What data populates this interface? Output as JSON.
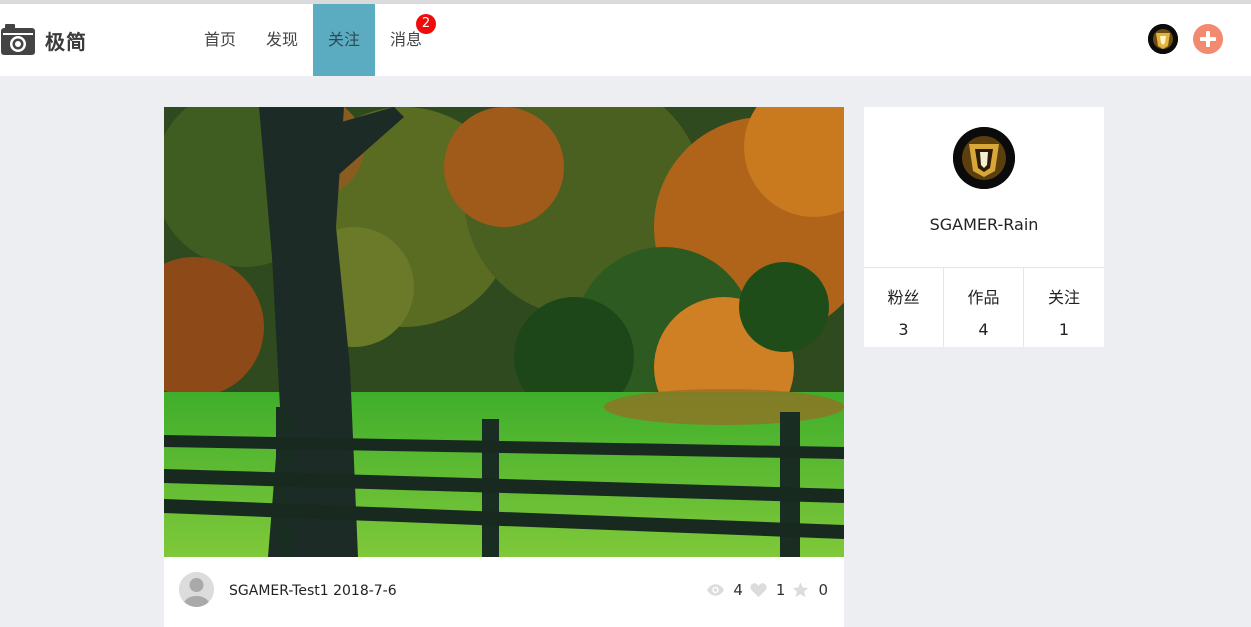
{
  "header": {
    "logo_text": "极简",
    "nav": [
      {
        "label": "首页",
        "active": false
      },
      {
        "label": "发现",
        "active": false
      },
      {
        "label": "关注",
        "active": true
      },
      {
        "label": "消息",
        "active": false,
        "badge": "2"
      }
    ],
    "avatar_icon": "user-avatar-icon",
    "add_icon": "plus-circle-icon"
  },
  "post": {
    "image_icon": "autumn-tree-fence-photo",
    "author": "SGAMER-Test1",
    "date": "2018-7-6",
    "views": "4",
    "likes": "1",
    "favorites": "0",
    "icons": {
      "views": "eye-icon",
      "likes": "heart-icon",
      "favorites": "star-icon"
    }
  },
  "profile": {
    "name": "SGAMER-Rain",
    "stats": [
      {
        "label": "粉丝",
        "value": "3"
      },
      {
        "label": "作品",
        "value": "4"
      },
      {
        "label": "关注",
        "value": "1"
      }
    ]
  },
  "colors": {
    "nav_active": "#5bacc1",
    "badge": "#f00b0b",
    "add_button": "#f28a70",
    "page_background": "#eceef1"
  }
}
